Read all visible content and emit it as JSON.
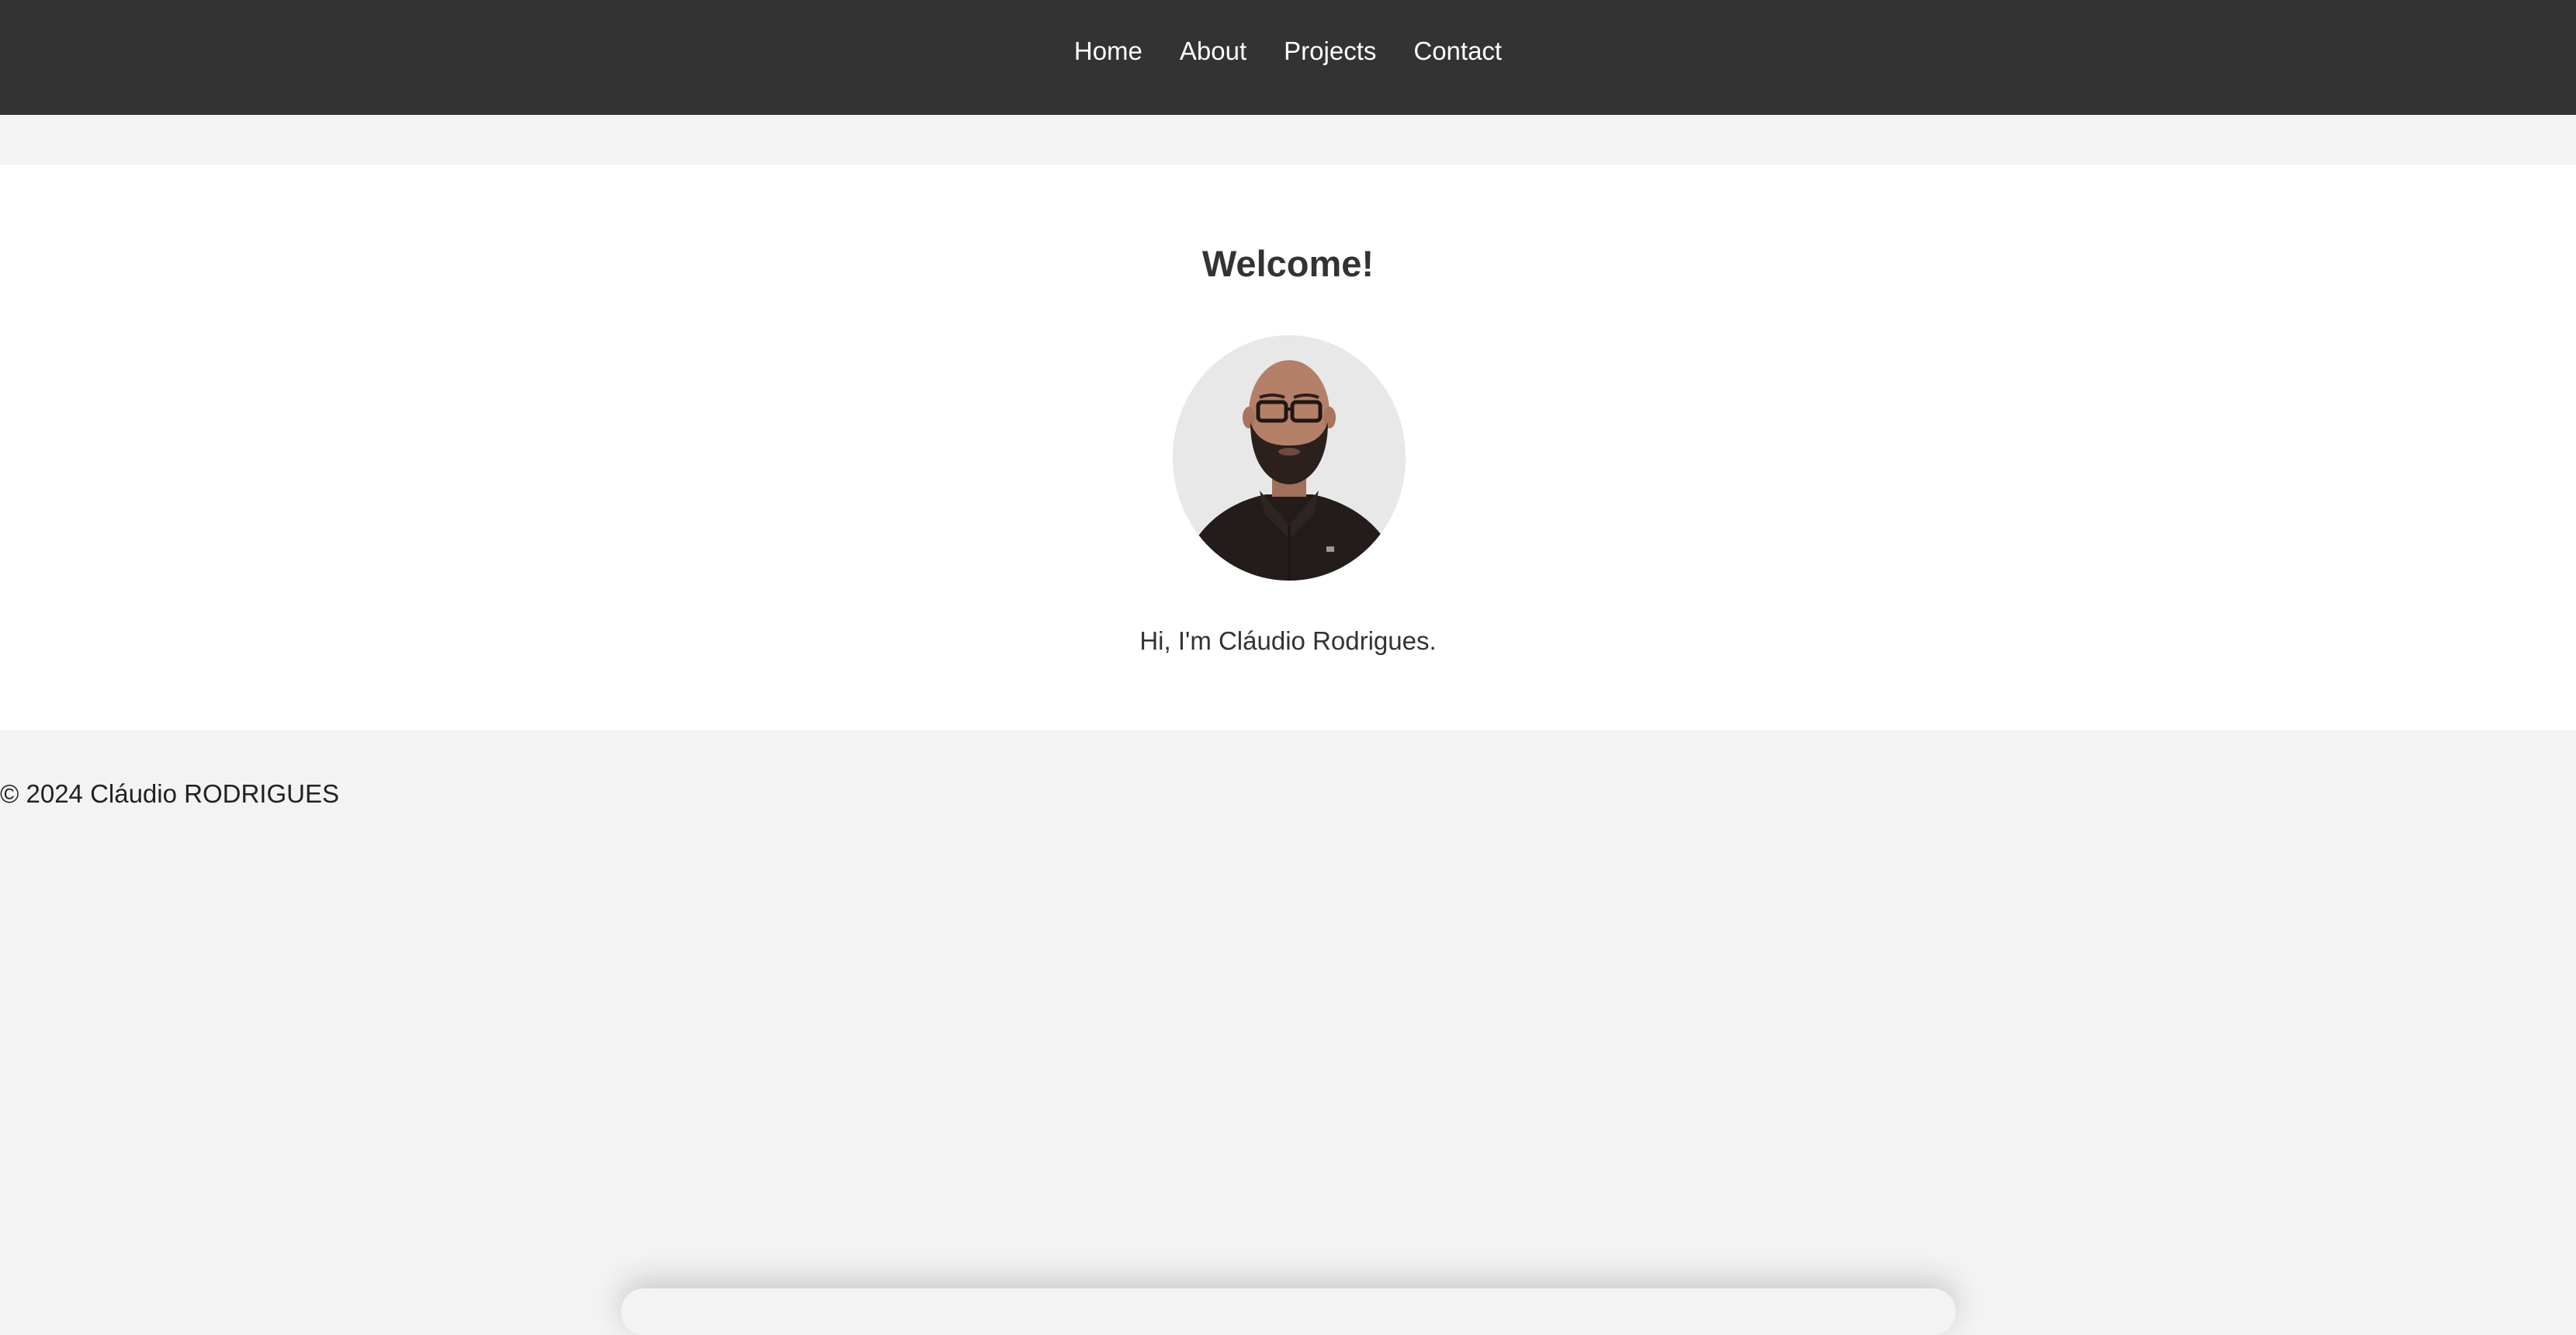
{
  "nav": {
    "items": [
      {
        "label": "Home"
      },
      {
        "label": "About"
      },
      {
        "label": "Projects"
      },
      {
        "label": "Contact"
      }
    ]
  },
  "hero": {
    "title": "Welcome!",
    "intro": "Hi, I'm Cláudio Rodrigues."
  },
  "footer": {
    "copyright": "© 2024 Cláudio RODRIGUES"
  },
  "colors": {
    "nav_bg": "#333333",
    "page_bg": "#f3f3f3",
    "hero_bg": "#ffffff",
    "text": "#333333"
  }
}
